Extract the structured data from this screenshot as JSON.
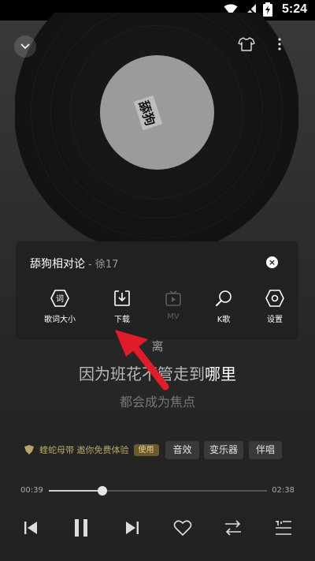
{
  "status_bar": {
    "time": "5:24"
  },
  "album": {
    "label_text": "舔狗"
  },
  "popup": {
    "song_title": "舔狗相对论",
    "artist": "- 徐17",
    "close_symbol": "×",
    "actions": [
      {
        "label": "歌词大小",
        "icon": "lyric-size-icon",
        "enabled": true
      },
      {
        "label": "下载",
        "icon": "download-icon",
        "enabled": true
      },
      {
        "label": "MV",
        "icon": "tv-icon",
        "enabled": false
      },
      {
        "label": "K歌",
        "icon": "microphone-icon",
        "enabled": true
      },
      {
        "label": "设置",
        "icon": "settings-icon",
        "enabled": true
      }
    ]
  },
  "lyrics": {
    "behind_panel": "离",
    "current_before": "因为班花不管走到",
    "current_highlight": "哪里",
    "next": "都会成为焦点"
  },
  "promo": {
    "text": "蝰蛇母带 邀你免费体验",
    "badge": "使用"
  },
  "chips": [
    "音效",
    "变乐器",
    "伴唱"
  ],
  "playback": {
    "current_time": "00:39",
    "total_time": "02:38",
    "progress": 0.247
  },
  "colors": {
    "highlight": "#ffffff",
    "promo": "#b7a56a",
    "arrow": "#e01b2a"
  }
}
